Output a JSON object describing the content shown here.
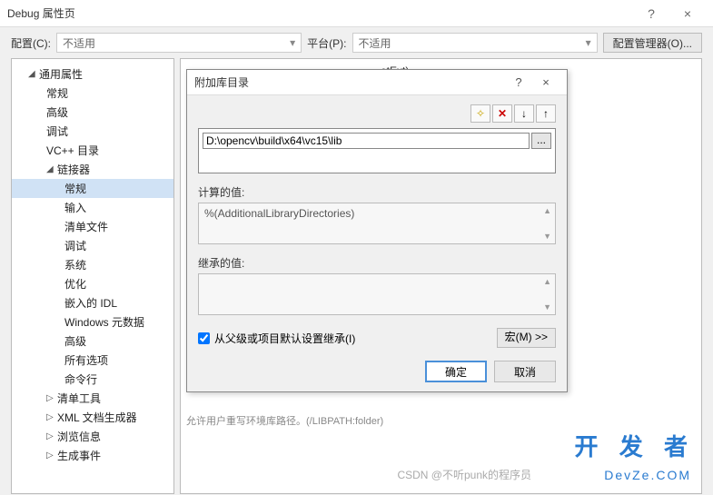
{
  "window": {
    "title": "Debug 属性页",
    "help": "?",
    "close": "×"
  },
  "toolbar": {
    "config_label": "配置(C):",
    "config_value": "不适用",
    "platform_label": "平台(P):",
    "platform_value": "不适用",
    "manager": "配置管理器(O)..."
  },
  "tree": {
    "n0": "通用属性",
    "n1": "常规",
    "n2": "高级",
    "n3": "调试",
    "n4": "VC++ 目录",
    "n5": "链接器",
    "n6": "常规",
    "n7": "输入",
    "n8": "清单文件",
    "n9": "调试",
    "n10": "系统",
    "n11": "优化",
    "n12": "嵌入的 IDL",
    "n13": "Windows 元数据",
    "n14": "高级",
    "n15": "所有选项",
    "n16": "命令行",
    "n17": "清单工具",
    "n18": "XML 文档生成器",
    "n19": "浏览信息",
    "n20": "生成事件"
  },
  "bg": {
    "text1": "etExt)",
    "text2": "允许用户重写环境库路径。(/LIBPATH:folder)"
  },
  "dialog": {
    "title": "附加库目录",
    "help": "?",
    "close": "×",
    "path": "D:\\opencv\\build\\x64\\vc15\\lib",
    "computed_label": "计算的值:",
    "computed_value": "%(AdditionalLibraryDirectories)",
    "inherited_label": "继承的值:",
    "inherit_checkbox": "从父级或项目默认设置继承(I)",
    "macro": "宏(M) >>",
    "ok": "确定",
    "cancel": "取消",
    "icons": {
      "new": "✧",
      "del": "✕",
      "down": "↓",
      "up": "↑"
    }
  },
  "watermark": {
    "logo": "开 发 者",
    "site": "DevZe.COM",
    "csdn": "CSDN @不听punk的程序员"
  }
}
